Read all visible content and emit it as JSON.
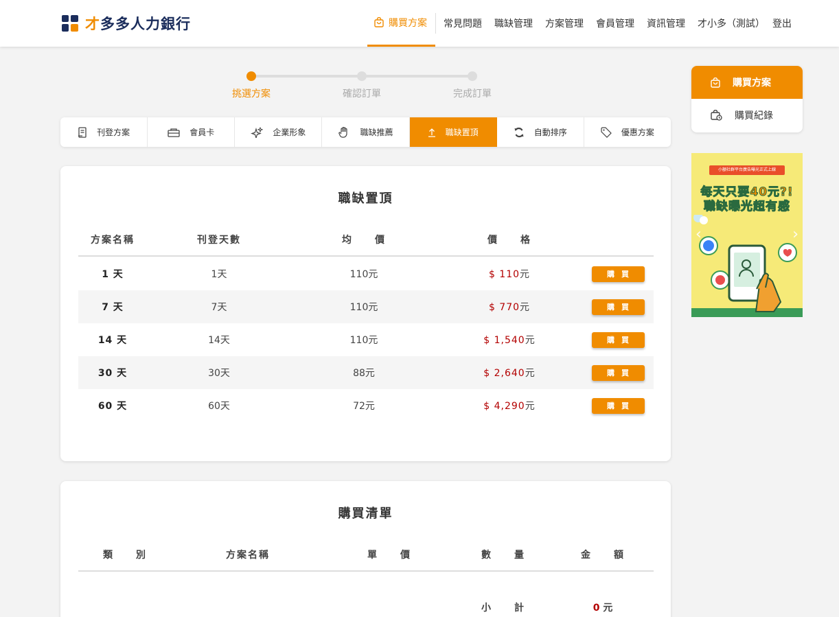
{
  "app": {
    "logo_first_char": "才",
    "logo_rest": "多多人力銀行"
  },
  "nav": {
    "active": "購買方案",
    "items": [
      "常見問題",
      "職缺管理",
      "方案管理",
      "會員管理",
      "資訊管理",
      "才小多（測試）",
      "登出"
    ]
  },
  "stepper": {
    "steps": [
      "挑選方案",
      "確認訂單",
      "完成訂單"
    ],
    "active_index": 0
  },
  "category_tabs": [
    {
      "label": "刊登方案",
      "icon": "receipt-icon"
    },
    {
      "label": "會員卡",
      "icon": "card-icon"
    },
    {
      "label": "企業形象",
      "icon": "sparkle-icon"
    },
    {
      "label": "職缺推薦",
      "icon": "hand-icon"
    },
    {
      "label": "職缺置頂",
      "icon": "arrow-up-icon",
      "active": true
    },
    {
      "label": "自動排序",
      "icon": "refresh-icon"
    },
    {
      "label": "優惠方案",
      "icon": "tag-icon"
    }
  ],
  "plan_table": {
    "title": "職缺置頂",
    "headers": [
      "方案名稱",
      "刊登天數",
      "均　　價",
      "價　　格"
    ],
    "rows": [
      {
        "name": "1 天",
        "days": "1天",
        "avg": "110元",
        "price_prefix": "$ 110",
        "price_unit": "元"
      },
      {
        "name": "7 天",
        "days": "7天",
        "avg": "110元",
        "price_prefix": "$ 770",
        "price_unit": "元"
      },
      {
        "name": "14 天",
        "days": "14天",
        "avg": "110元",
        "price_prefix": "$ 1,540",
        "price_unit": "元"
      },
      {
        "name": "30 天",
        "days": "30天",
        "avg": "88元",
        "price_prefix": "$ 2,640",
        "price_unit": "元"
      },
      {
        "name": "60 天",
        "days": "60天",
        "avg": "72元",
        "price_prefix": "$ 4,290",
        "price_unit": "元"
      }
    ],
    "buy_label": "購買"
  },
  "cart": {
    "title": "購買清單",
    "headers": [
      "類　　別",
      "方案名稱",
      "單　　價",
      "數　　量",
      "金　　額"
    ],
    "subtotal_label": "小　　計",
    "subtotal_value": "0",
    "subtotal_unit": "元"
  },
  "side_menu": {
    "items": [
      "購買方案",
      "購買紀錄"
    ]
  },
  "banner": {
    "ribbon": "小額社群平台廣告曝光正式上線",
    "line1": "每天只要40元?!",
    "line2": "職缺曝光超有感"
  },
  "colors": {
    "accent": "#f08c00",
    "brand": "#1b2d5c",
    "price": "#b30000"
  }
}
